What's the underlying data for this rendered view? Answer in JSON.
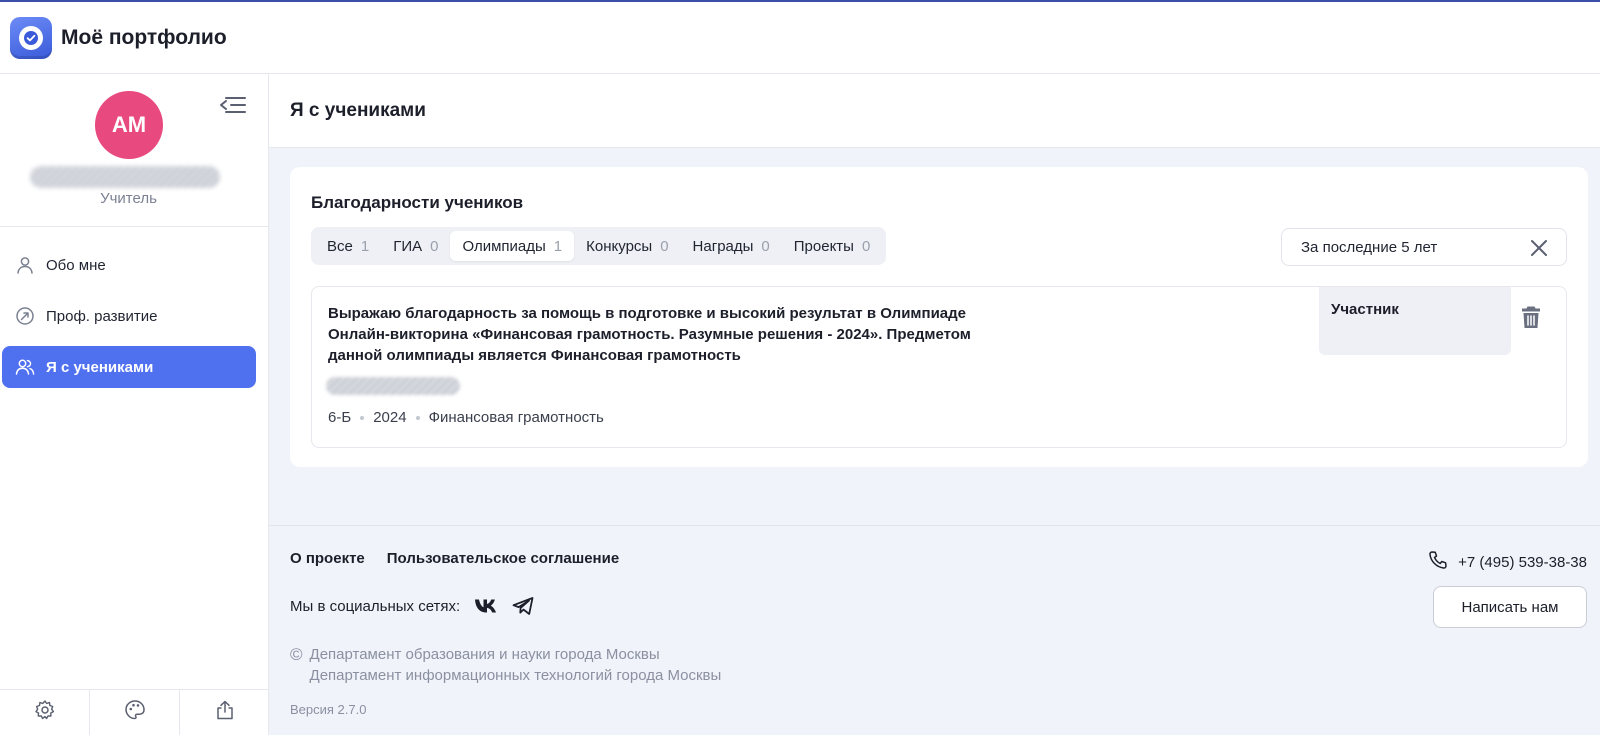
{
  "app": {
    "title": "Моё портфолио"
  },
  "sidebar": {
    "avatar_initials": "АМ",
    "role": "Учитель",
    "nav": [
      {
        "label": "Обо мне",
        "icon": "user-icon"
      },
      {
        "label": "Проф. развитие",
        "icon": "growth-icon"
      },
      {
        "label": "Я с учениками",
        "icon": "users-icon",
        "active": true
      }
    ],
    "bottom_icons": [
      "gear-icon",
      "palette-icon",
      "share-icon"
    ]
  },
  "page": {
    "title": "Я с учениками"
  },
  "card": {
    "title": "Благодарности учеников",
    "tabs": [
      {
        "label": "Все",
        "count": "1"
      },
      {
        "label": "ГИА",
        "count": "0"
      },
      {
        "label": "Олимпиады",
        "count": "1",
        "active": true
      },
      {
        "label": "Конкурсы",
        "count": "0"
      },
      {
        "label": "Награды",
        "count": "0"
      },
      {
        "label": "Проекты",
        "count": "0"
      }
    ],
    "period": "За последние 5 лет",
    "item": {
      "text": "Выражаю благодарность за помощь в подготовке и высокий результат в Олимпиаде Онлайн-викторина «Финансовая грамотность. Разумные решения - 2024». Предметом данной олимпиады является Финансовая грамотность",
      "class": "6-Б",
      "year": "2024",
      "subject": "Финансовая грамотность",
      "status": "Участник"
    }
  },
  "footer": {
    "link_about": "О проекте",
    "link_agreement": "Пользовательское соглашение",
    "phone": "+7 (495) 539-38-38",
    "social_label": "Мы в социальных сетях:",
    "write_button": "Написать нам",
    "copyright_symbol": "©",
    "org_1": "Департамент образования и науки города Москвы",
    "org_2": "Департамент информационных технологий города Москвы",
    "version": "Версия 2.7.0"
  },
  "colors": {
    "accent": "#4f71ef",
    "avatar": "#e8497f",
    "background": "#f1f3fb"
  }
}
